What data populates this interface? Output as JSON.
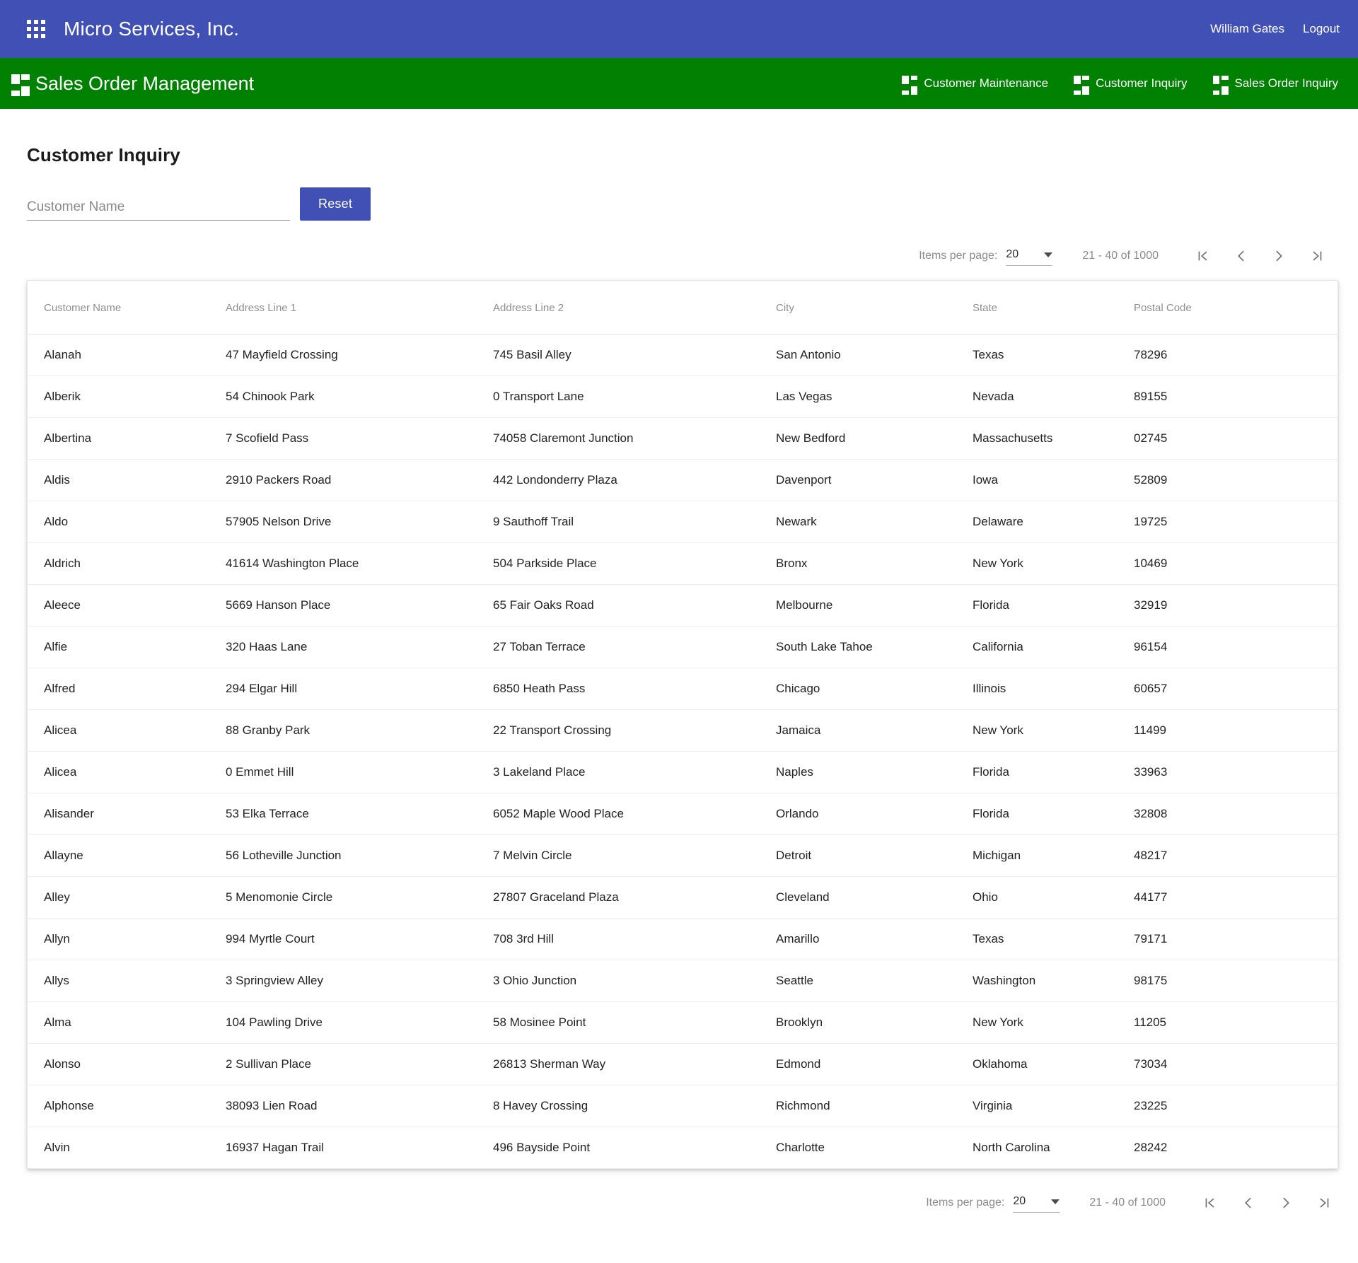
{
  "topbar": {
    "apps_icon": "apps-grid-icon",
    "brand": "Micro Services, Inc.",
    "user": "William Gates",
    "logout": "Logout",
    "background": "#4150b5"
  },
  "navbar": {
    "brand_icon": "dashboard-icon",
    "brand": "Sales Order Management",
    "background": "#018101",
    "items": [
      {
        "label": "Customer Maintenance",
        "icon": "dashboard-icon"
      },
      {
        "label": "Customer Inquiry",
        "icon": "dashboard-icon"
      },
      {
        "label": "Sales Order Inquiry",
        "icon": "dashboard-icon"
      }
    ]
  },
  "page": {
    "title": "Customer Inquiry"
  },
  "search": {
    "placeholder": "Customer Name",
    "value": "",
    "reset_label": "Reset",
    "reset_color": "#4150b5"
  },
  "paginator": {
    "items_per_page_label": "Items per page:",
    "items_per_page_value": "20",
    "range_label": "21 - 40 of 1000",
    "first_page_icon": "first-page-icon",
    "prev_page_icon": "previous-page-icon",
    "next_page_icon": "next-page-icon",
    "last_page_icon": "last-page-icon"
  },
  "table": {
    "columns": [
      "Customer Name",
      "Address Line 1",
      "Address Line 2",
      "City",
      "State",
      "Postal Code"
    ],
    "rows": [
      [
        "Alanah",
        "47 Mayfield Crossing",
        "745 Basil Alley",
        "San Antonio",
        "Texas",
        "78296"
      ],
      [
        "Alberik",
        "54 Chinook Park",
        "0 Transport Lane",
        "Las Vegas",
        "Nevada",
        "89155"
      ],
      [
        "Albertina",
        "7 Scofield Pass",
        "74058 Claremont Junction",
        "New Bedford",
        "Massachusetts",
        "02745"
      ],
      [
        "Aldis",
        "2910 Packers Road",
        "442 Londonderry Plaza",
        "Davenport",
        "Iowa",
        "52809"
      ],
      [
        "Aldo",
        "57905 Nelson Drive",
        "9 Sauthoff Trail",
        "Newark",
        "Delaware",
        "19725"
      ],
      [
        "Aldrich",
        "41614 Washington Place",
        "504 Parkside Place",
        "Bronx",
        "New York",
        "10469"
      ],
      [
        "Aleece",
        "5669 Hanson Place",
        "65 Fair Oaks Road",
        "Melbourne",
        "Florida",
        "32919"
      ],
      [
        "Alfie",
        "320 Haas Lane",
        "27 Toban Terrace",
        "South Lake Tahoe",
        "California",
        "96154"
      ],
      [
        "Alfred",
        "294 Elgar Hill",
        "6850 Heath Pass",
        "Chicago",
        "Illinois",
        "60657"
      ],
      [
        "Alicea",
        "88 Granby Park",
        "22 Transport Crossing",
        "Jamaica",
        "New York",
        "11499"
      ],
      [
        "Alicea",
        "0 Emmet Hill",
        "3 Lakeland Place",
        "Naples",
        "Florida",
        "33963"
      ],
      [
        "Alisander",
        "53 Elka Terrace",
        "6052 Maple Wood Place",
        "Orlando",
        "Florida",
        "32808"
      ],
      [
        "Allayne",
        "56 Lotheville Junction",
        "7 Melvin Circle",
        "Detroit",
        "Michigan",
        "48217"
      ],
      [
        "Alley",
        "5 Menomonie Circle",
        "27807 Graceland Plaza",
        "Cleveland",
        "Ohio",
        "44177"
      ],
      [
        "Allyn",
        "994 Myrtle Court",
        "708 3rd Hill",
        "Amarillo",
        "Texas",
        "79171"
      ],
      [
        "Allys",
        "3 Springview Alley",
        "3 Ohio Junction",
        "Seattle",
        "Washington",
        "98175"
      ],
      [
        "Alma",
        "104 Pawling Drive",
        "58 Mosinee Point",
        "Brooklyn",
        "New York",
        "11205"
      ],
      [
        "Alonso",
        "2 Sullivan Place",
        "26813 Sherman Way",
        "Edmond",
        "Oklahoma",
        "73034"
      ],
      [
        "Alphonse",
        "38093 Lien Road",
        "8 Havey Crossing",
        "Richmond",
        "Virginia",
        "23225"
      ],
      [
        "Alvin",
        "16937 Hagan Trail",
        "496 Bayside Point",
        "Charlotte",
        "North Carolina",
        "28242"
      ]
    ]
  }
}
